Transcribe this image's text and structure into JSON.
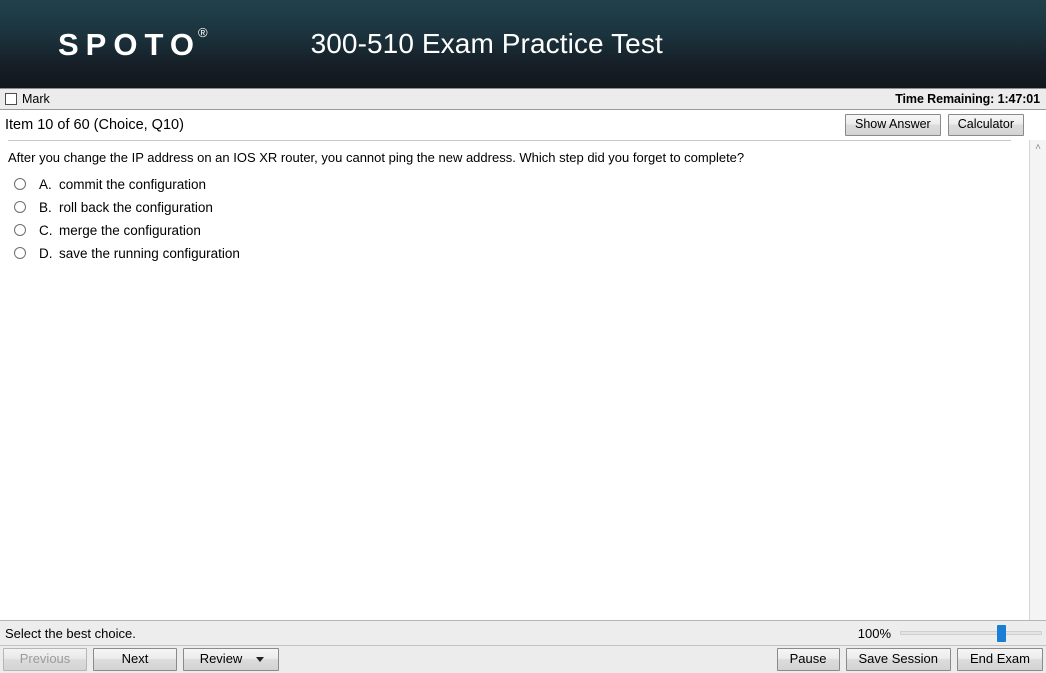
{
  "header": {
    "logo_text": "SPOTO",
    "logo_registered": "®",
    "title": "300-510 Exam Practice Test"
  },
  "markbar": {
    "mark_label": "Mark",
    "time_remaining": "Time Remaining: 1:47:01"
  },
  "itembar": {
    "item_label": "Item 10 of 60 (Choice, Q10)",
    "show_answer_label": "Show Answer",
    "calculator_label": "Calculator"
  },
  "question": {
    "text": "After you change the IP address on an IOS XR router, you cannot ping the new address. Which step did you forget to complete?",
    "options": [
      {
        "letter": "A.",
        "text": "commit the configuration",
        "selected": false
      },
      {
        "letter": "B.",
        "text": "roll back the configuration",
        "selected": false
      },
      {
        "letter": "C.",
        "text": "merge the configuration",
        "selected": false
      },
      {
        "letter": "D.",
        "text": "save the running configuration",
        "selected": false
      }
    ]
  },
  "scrollbar": {
    "up_arrow": "˄"
  },
  "statusbar": {
    "instruction": "Select the best choice.",
    "zoom_level": "100%",
    "zoom_accent_color": "#1a7fd4"
  },
  "navbar": {
    "previous_label": "Previous",
    "next_label": "Next",
    "review_label": "Review",
    "pause_label": "Pause",
    "save_session_label": "Save Session",
    "end_exam_label": "End Exam"
  }
}
